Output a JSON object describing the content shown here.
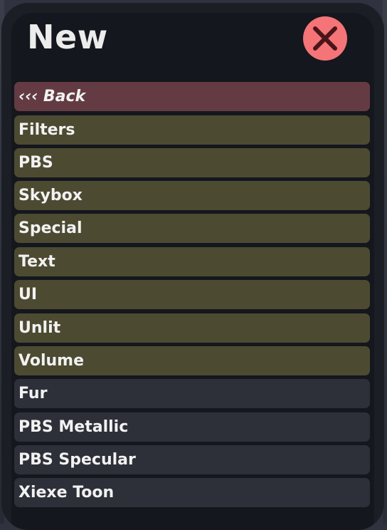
{
  "window": {
    "title": "New",
    "close_icon": "close-x-icon"
  },
  "colors": {
    "panel": "#1b1e25",
    "close": "#f47478",
    "back": "#643b43",
    "category": "#4d4a32",
    "shader": "#2d3039",
    "text": "#f2f2f2"
  },
  "menu": {
    "items": [
      {
        "label": "‹‹‹ Back",
        "kind": "back"
      },
      {
        "label": "Filters",
        "kind": "category"
      },
      {
        "label": "PBS",
        "kind": "category"
      },
      {
        "label": "Skybox",
        "kind": "category"
      },
      {
        "label": "Special",
        "kind": "category"
      },
      {
        "label": "Text",
        "kind": "category"
      },
      {
        "label": "UI",
        "kind": "category"
      },
      {
        "label": "Unlit",
        "kind": "category"
      },
      {
        "label": "Volume",
        "kind": "category"
      },
      {
        "label": "Fur",
        "kind": "shader"
      },
      {
        "label": "PBS Metallic",
        "kind": "shader"
      },
      {
        "label": "PBS Specular",
        "kind": "shader"
      },
      {
        "label": "Xiexe Toon",
        "kind": "shader"
      }
    ]
  }
}
